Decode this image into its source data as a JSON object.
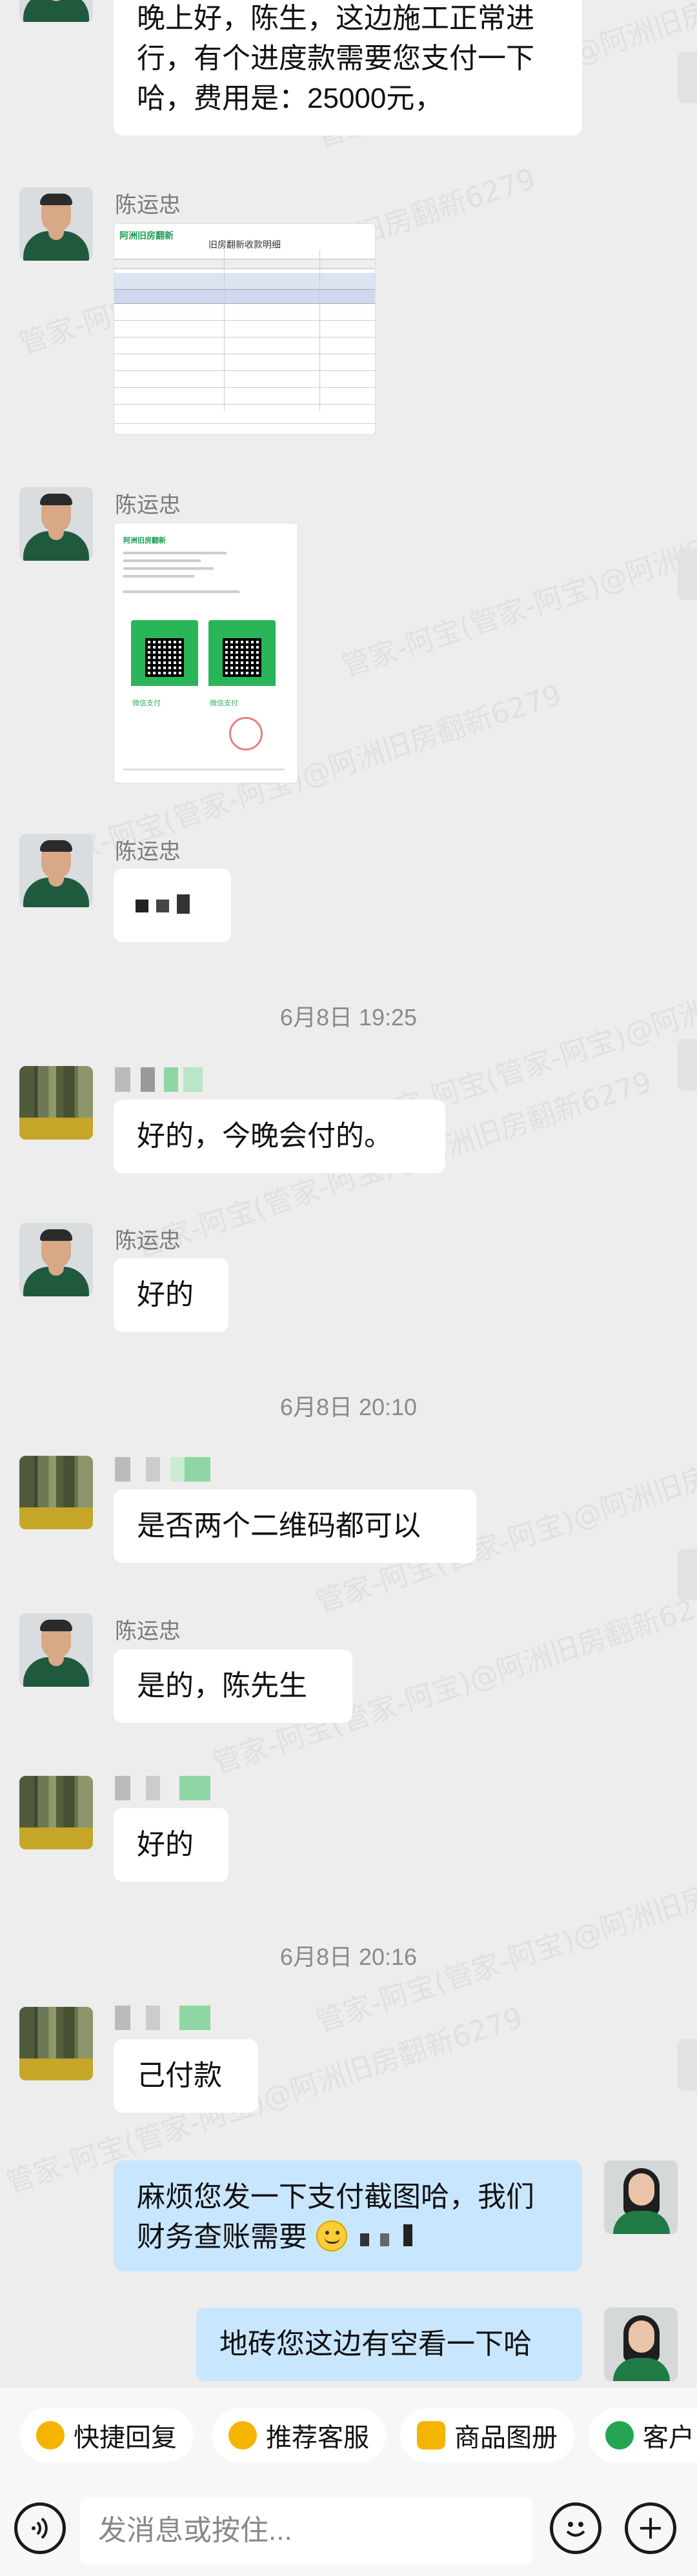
{
  "messages": {
    "m1_text": "晚上好，陈生，这边施工正常进行，有个进度款需要您支付一下哈，费用是：25000元，",
    "agent_name": "陈运忠",
    "m5_text": "好的，今晚会付的。",
    "m6_text": "好的",
    "m7_text": "是否两个二维码都可以",
    "m8_text": "是的，陈先生",
    "m9_text": "好的",
    "m10_text": "己付款",
    "m11_text": "麻烦您发一下支付截图哈，我们财务查账需要",
    "m12_text": "地砖您这边有空看一下哈"
  },
  "timestamps": {
    "t1": "6月8日  19:25",
    "t2": "6月8日  20:10",
    "t3": "6月8日  20:16"
  },
  "doc1": {
    "logo": "阿洲旧房翻新",
    "title": "旧房翻新收款明细"
  },
  "doc2": {
    "logo": "阿洲旧房翻新",
    "pay1": "微信支付",
    "pay2": "微信支付"
  },
  "watermark": "管家-阿宝(管家-阿宝)@阿洲旧房翻新6279",
  "quick_replies": [
    {
      "label": "快捷回复",
      "icon": "quick-reply-icon"
    },
    {
      "label": "推荐客服",
      "icon": "recommend-icon"
    },
    {
      "label": "商品图册",
      "icon": "catalog-icon"
    },
    {
      "label": "客户",
      "icon": "customer-icon"
    }
  ],
  "input": {
    "placeholder": "发消息或按住..."
  },
  "colors": {
    "me_bubble": "#c9e6ff",
    "other_bubble": "#ffffff",
    "background": "#ededed",
    "accent_green": "#23a554"
  }
}
